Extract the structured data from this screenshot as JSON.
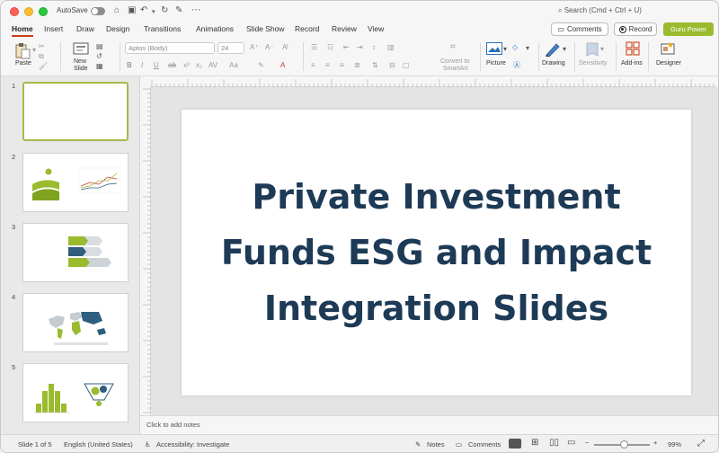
{
  "window": {
    "autosave_label": "AutoSave",
    "search_placeholder": "Search (Cmd + Ctrl + U)"
  },
  "tabs": [
    {
      "label": "Home",
      "active": true
    },
    {
      "label": "Insert"
    },
    {
      "label": "Draw"
    },
    {
      "label": "Design"
    },
    {
      "label": "Transitions"
    },
    {
      "label": "Animations"
    },
    {
      "label": "Slide Show"
    },
    {
      "label": "Record"
    },
    {
      "label": "Review"
    },
    {
      "label": "View"
    }
  ],
  "header_buttons": {
    "comments": "Comments",
    "record": "Record",
    "guru": "Guru Power"
  },
  "ribbon": {
    "paste": "Paste",
    "new_slide_line1": "New",
    "new_slide_line2": "Slide",
    "font_name": "Aptos (Body)",
    "font_size": "24",
    "convert_line1": "Convert to",
    "convert_line2": "SmartArt",
    "picture": "Picture",
    "drawing": "Drawing",
    "sensitivity": "Sensitivity",
    "addins": "Add-ins",
    "designer": "Designer"
  },
  "slides": [
    {
      "number": "1",
      "selected": true
    },
    {
      "number": "2"
    },
    {
      "number": "3"
    },
    {
      "number": "4"
    },
    {
      "number": "5"
    }
  ],
  "current_slide": {
    "title_line1": "Private Investment",
    "title_line2": "Funds ESG and Impact",
    "title_line3": "Integration Slides"
  },
  "notes_placeholder": "Click to add notes",
  "status": {
    "slide_count": "Slide 1 of 5",
    "language": "English (United States)",
    "accessibility": "Accessibility: Investigate",
    "notes": "Notes",
    "comments": "Comments",
    "zoom": "99%"
  },
  "colors": {
    "accent_tab": "#c43e1c",
    "guru_green": "#9bbb2f",
    "title_navy": "#1d3a56",
    "chart_green": "#9bbb2f",
    "chart_blue": "#2f5e7e"
  }
}
